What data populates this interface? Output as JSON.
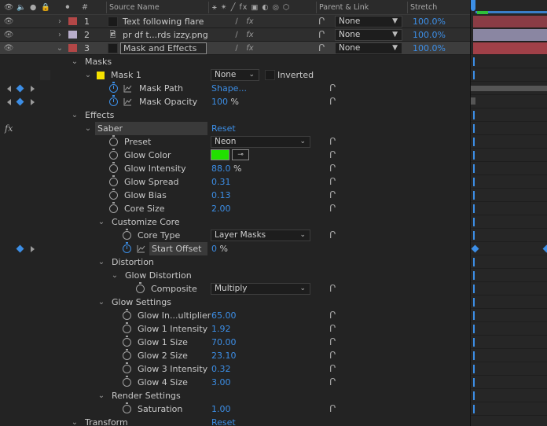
{
  "header": {
    "source_name": "Source Name",
    "parent_link": "Parent & Link",
    "stretch": "Stretch",
    "switch_icons": "⚹ ✴ ╱ fx ▣ ◐ ◎ ⬡"
  },
  "layers": [
    {
      "num": "1",
      "name": "Text following flare",
      "color": "#b34747",
      "parent": "None",
      "stretch": "100.0%",
      "selected": false
    },
    {
      "num": "2",
      "name": "pr df t...rds izzy.png",
      "color": "#b8aecb",
      "parent": "None",
      "stretch": "100.0%",
      "selected": false
    },
    {
      "num": "3",
      "name": "Mask and Effects",
      "color": "#b34747",
      "parent": "None",
      "stretch": "100.0%",
      "selected": true
    }
  ],
  "masks": {
    "label": "Masks",
    "mask1_label": "Mask 1",
    "mask1_color": "#f5e100",
    "mask_mode": "None",
    "inverted_label": "Inverted",
    "mask_path_label": "Mask Path",
    "mask_path_value": "Shape...",
    "mask_opacity_label": "Mask Opacity",
    "mask_opacity_value": "100",
    "mask_opacity_unit": "%"
  },
  "effects": {
    "label": "Effects",
    "fx_label": "fx",
    "saber_label": "Saber",
    "reset_label": "Reset",
    "preset_label": "Preset",
    "preset_value": "Neon",
    "glow_color_label": "Glow Color",
    "glow_color_value": "#21e000",
    "glow_intensity_label": "Glow Intensity",
    "glow_intensity_value": "88.0",
    "glow_intensity_unit": "%",
    "glow_spread_label": "Glow Spread",
    "glow_spread_value": "0.31",
    "glow_bias_label": "Glow Bias",
    "glow_bias_value": "0.13",
    "core_size_label": "Core Size",
    "core_size_value": "2.00",
    "customize_core_label": "Customize Core",
    "core_type_label": "Core Type",
    "core_type_value": "Layer Masks",
    "start_offset_label": "Start Offset",
    "start_offset_value": "0",
    "start_offset_unit": "%",
    "distortion_label": "Distortion",
    "glow_distortion_label": "Glow Distortion",
    "composite_label": "Composite",
    "composite_value": "Multiply",
    "glow_settings_label": "Glow Settings",
    "glow_multiplier_label": "Glow In...ultiplier",
    "glow_multiplier_value": "65.00",
    "glow1_intensity_label": "Glow 1 Intensity",
    "glow1_intensity_value": "1.92",
    "glow1_size_label": "Glow 1 Size",
    "glow1_size_value": "70.00",
    "glow2_size_label": "Glow 2 Size",
    "glow2_size_value": "23.10",
    "glow3_intensity_label": "Glow 3 Intensity",
    "glow3_intensity_value": "0.32",
    "glow4_size_label": "Glow 4 Size",
    "glow4_size_value": "3.00",
    "render_settings_label": "Render Settings",
    "saturation_label": "Saturation",
    "saturation_value": "1.00",
    "transform_label": "Transform",
    "transform_reset": "Reset"
  },
  "timeline": {
    "layer_bar_colors": [
      "#8a3c45",
      "#8a86a2",
      "#a04048"
    ],
    "accent": "#3c8ee6"
  }
}
